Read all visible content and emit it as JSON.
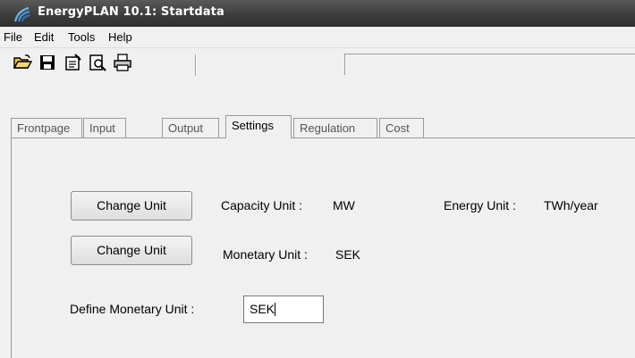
{
  "window": {
    "title": "EnergyPLAN 10.1: Startdata"
  },
  "menu": [
    "File",
    "Edit",
    "Tools",
    "Help"
  ],
  "toolbar": {
    "buttons": [
      "open-folder-icon",
      "save-icon",
      "properties-icon",
      "print-preview-icon",
      "print-icon"
    ]
  },
  "tabs": [
    "Frontpage",
    "Input",
    "Output",
    "Settings",
    "Regulation",
    "Cost"
  ],
  "active_tab": "Settings",
  "settings": {
    "change_unit_1": "Change Unit",
    "capacity_label": "Capacity Unit :",
    "capacity_value": "MW",
    "energy_label": "Energy Unit :",
    "energy_value": "TWh/year",
    "change_unit_2": "Change Unit",
    "monetary_label": "Monetary Unit :",
    "monetary_value": "SEK",
    "define_label": "Define Monetary Unit :",
    "define_value": "SEK"
  }
}
